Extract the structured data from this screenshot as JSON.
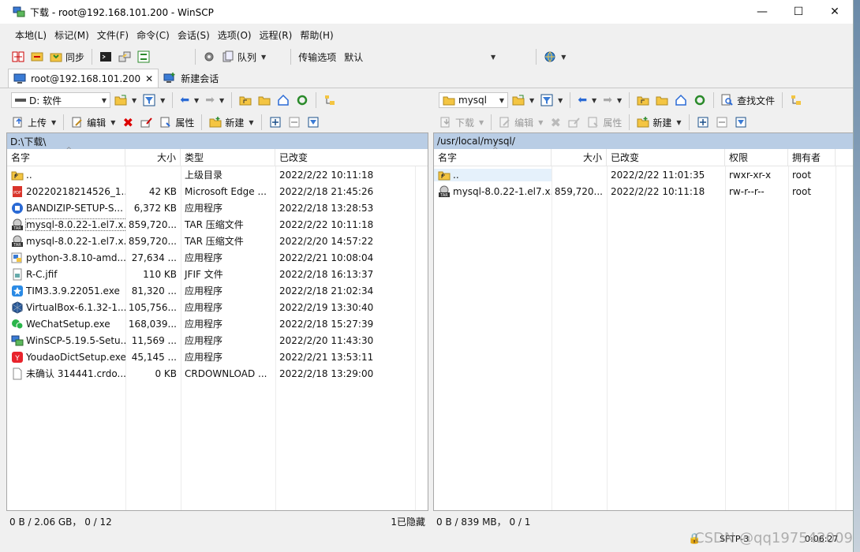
{
  "window": {
    "title": "下载 - root@192.168.101.200 - WinSCP",
    "minimize": "—",
    "maximize": "☐",
    "close": "✕"
  },
  "menu": [
    "本地(L)",
    "标记(M)",
    "文件(F)",
    "命令(C)",
    "会话(S)",
    "选项(O)",
    "远程(R)",
    "帮助(H)"
  ],
  "toolbar": {
    "sync_label": "同步",
    "queue_label": "队列",
    "transfer_label": "传输选项",
    "transfer_value": "默认"
  },
  "tabs": {
    "session": "root@192.168.101.200",
    "new_session": "新建会话"
  },
  "left": {
    "drive": "D: 软件",
    "upload": "上传",
    "edit": "编辑",
    "properties": "属性",
    "new": "新建",
    "path": "D:\\下载\\",
    "columns": [
      "名字",
      "大小",
      "类型",
      "已改变"
    ],
    "files": [
      {
        "name": "..",
        "size": "",
        "type": "上级目录",
        "changed": "2022/2/22   10:11:18",
        "icon": "parent-folder-icon"
      },
      {
        "name": "20220218214526_1...",
        "size": "42 KB",
        "type": "Microsoft Edge ...",
        "changed": "2022/2/18   21:45:26",
        "icon": "pdf-icon"
      },
      {
        "name": "BANDIZIP-SETUP-S...",
        "size": "6,372 KB",
        "type": "应用程序",
        "changed": "2022/2/18   13:28:53",
        "icon": "bandizip-icon"
      },
      {
        "name": "mysql-8.0.22-1.el7.x...",
        "size": "859,720...",
        "type": "TAR 压缩文件",
        "changed": "2022/2/22   10:11:18",
        "icon": "tar-icon"
      },
      {
        "name": "mysql-8.0.22-1.el7.x...",
        "size": "859,720...",
        "type": "TAR 压缩文件",
        "changed": "2022/2/20   14:57:22",
        "icon": "tar-icon"
      },
      {
        "name": "python-3.8.10-amd...",
        "size": "27,634 ...",
        "type": "应用程序",
        "changed": "2022/2/21   10:08:04",
        "icon": "python-icon"
      },
      {
        "name": "R-C.jfif",
        "size": "110 KB",
        "type": "JFIF 文件",
        "changed": "2022/2/18   16:13:37",
        "icon": "image-file-icon"
      },
      {
        "name": "TIM3.3.9.22051.exe",
        "size": "81,320 ...",
        "type": "应用程序",
        "changed": "2022/2/18   21:02:34",
        "icon": "tim-icon"
      },
      {
        "name": "VirtualBox-6.1.32-1...",
        "size": "105,756...",
        "type": "应用程序",
        "changed": "2022/2/19   13:30:40",
        "icon": "virtualbox-icon"
      },
      {
        "name": "WeChatSetup.exe",
        "size": "168,039...",
        "type": "应用程序",
        "changed": "2022/2/18   15:27:39",
        "icon": "wechat-icon"
      },
      {
        "name": "WinSCP-5.19.5-Setu...",
        "size": "11,569 ...",
        "type": "应用程序",
        "changed": "2022/2/20   11:43:30",
        "icon": "winscp-icon"
      },
      {
        "name": "YoudaoDictSetup.exe",
        "size": "45,145 ...",
        "type": "应用程序",
        "changed": "2022/2/21   13:53:11",
        "icon": "youdao-icon"
      },
      {
        "name": "未确认 314441.crdo...",
        "size": "0 KB",
        "type": "CRDOWNLOAD ...",
        "changed": "2022/2/18   13:29:00",
        "icon": "blank-file-icon"
      }
    ],
    "status_left": "0 B / 2.06 GB，  0 / 12",
    "status_right": "1已隐藏"
  },
  "right": {
    "dir": "mysql",
    "download": "下载",
    "edit": "编辑",
    "properties": "属性",
    "new": "新建",
    "find": "查找文件",
    "path": "/usr/local/mysql/",
    "columns": [
      "名字",
      "大小",
      "已改变",
      "权限",
      "拥有者"
    ],
    "files": [
      {
        "name": "..",
        "size": "",
        "changed": "2022/2/22   11:01:35",
        "perm": "rwxr-xr-x",
        "owner": "root",
        "icon": "parent-folder-icon"
      },
      {
        "name": "mysql-8.0.22-1.el7.x...",
        "size": "859,720...",
        "changed": "2022/2/22   10:11:18",
        "perm": "rw-r--r--",
        "owner": "root",
        "icon": "tar-icon"
      }
    ],
    "status": "0 B / 839 MB，  0 / 1"
  },
  "bottom": {
    "protocol": "SFTP-3",
    "time": "0:06:27",
    "watermark": "CSDN @qq1975420092"
  },
  "colors": {
    "path_bar": "#b9cde5",
    "selection": "#e5f1fb",
    "accent": "#0078d7"
  }
}
